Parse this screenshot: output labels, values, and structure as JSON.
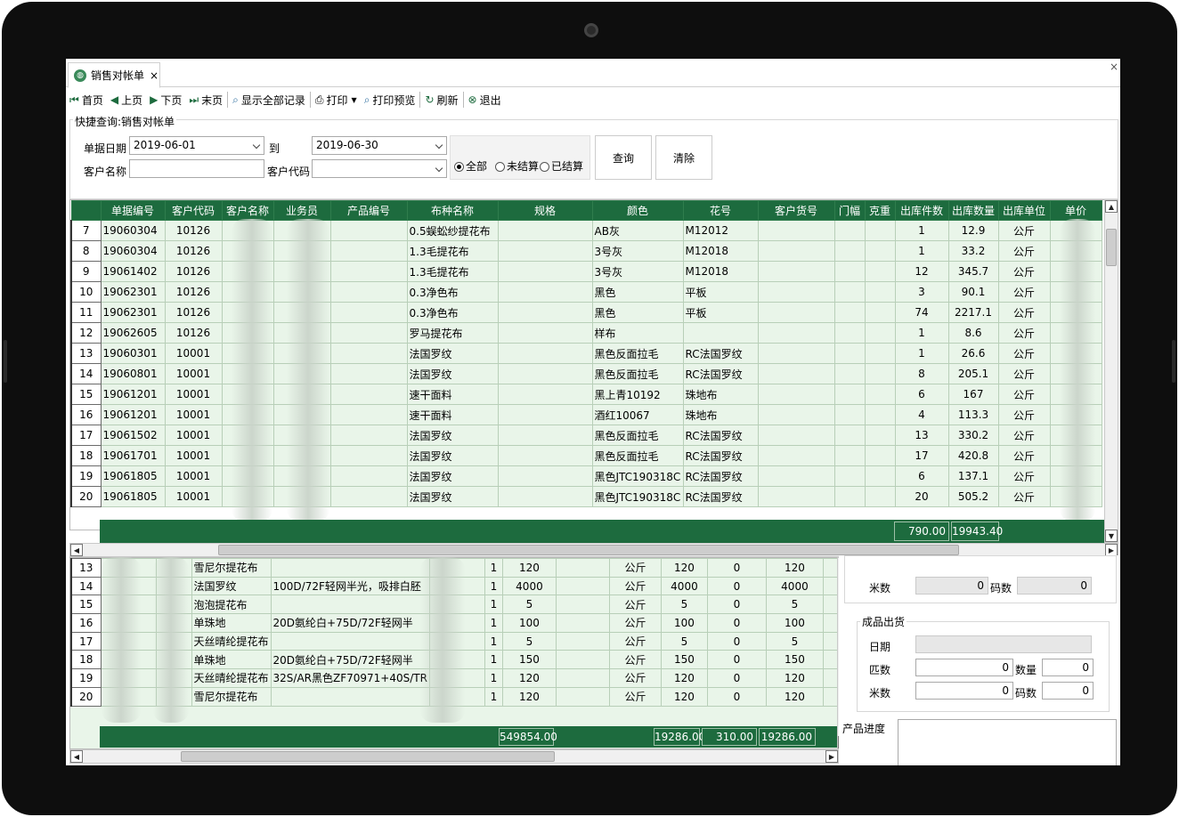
{
  "tab": {
    "title": "销售对帐单",
    "close": "×"
  },
  "window": {
    "close": "×"
  },
  "toolbar": {
    "first": "首页",
    "prev": "上页",
    "next": "下页",
    "last": "末页",
    "show_all": "显示全部记录",
    "print": "打印",
    "print_preview": "打印预览",
    "refresh": "刷新",
    "exit": "退出"
  },
  "query": {
    "legend": "快捷查询:销售对帐单",
    "date_label": "单据日期",
    "date_from": "2019-06-01",
    "to_label": "到",
    "date_to": "2019-06-30",
    "customer_name_label": "客户名称",
    "customer_name": "",
    "customer_code_label": "客户代码",
    "customer_code": "",
    "radio_all": "全部",
    "radio_unsettled": "未结算",
    "radio_settled": "已结算",
    "radio_selected": "全部",
    "query_button": "查询",
    "clear_button": "清除"
  },
  "grid1": {
    "headers": [
      "单据编号",
      "客户代码",
      "客户名称",
      "业务员",
      "产品编号",
      "布种名称",
      "规格",
      "颜色",
      "花号",
      "客户货号",
      "门幅",
      "克重",
      "出库件数",
      "出库数量",
      "出库单位",
      "单价"
    ],
    "rows": [
      {
        "n": "7",
        "doc": "19060304",
        "code": "10126",
        "fabric": "0.5蜈蚣纱提花布",
        "color": "AB灰",
        "pattern": "M12012",
        "pcs": "1",
        "qty": "12.9",
        "unit": "公斤"
      },
      {
        "n": "8",
        "doc": "19060304",
        "code": "10126",
        "fabric": "1.3毛提花布",
        "color": "3号灰",
        "pattern": "M12018",
        "pcs": "1",
        "qty": "33.2",
        "unit": "公斤"
      },
      {
        "n": "9",
        "doc": "19061402",
        "code": "10126",
        "fabric": "1.3毛提花布",
        "color": "3号灰",
        "pattern": "M12018",
        "pcs": "12",
        "qty": "345.7",
        "unit": "公斤"
      },
      {
        "n": "10",
        "doc": "19062301",
        "code": "10126",
        "fabric": "0.3净色布",
        "color": "黑色",
        "pattern": "平板",
        "pcs": "3",
        "qty": "90.1",
        "unit": "公斤"
      },
      {
        "n": "11",
        "doc": "19062301",
        "code": "10126",
        "fabric": "0.3净色布",
        "color": "黑色",
        "pattern": "平板",
        "pcs": "74",
        "qty": "2217.1",
        "unit": "公斤"
      },
      {
        "n": "12",
        "doc": "19062605",
        "code": "10126",
        "fabric": "罗马提花布",
        "color": "样布",
        "pattern": "",
        "pcs": "1",
        "qty": "8.6",
        "unit": "公斤"
      },
      {
        "n": "13",
        "doc": "19060301",
        "code": "10001",
        "fabric": "法国罗纹",
        "color": "黑色反面拉毛",
        "pattern": "RC法国罗纹",
        "pcs": "1",
        "qty": "26.6",
        "unit": "公斤"
      },
      {
        "n": "14",
        "doc": "19060801",
        "code": "10001",
        "fabric": "法国罗纹",
        "color": "黑色反面拉毛",
        "pattern": "RC法国罗纹",
        "pcs": "8",
        "qty": "205.1",
        "unit": "公斤"
      },
      {
        "n": "15",
        "doc": "19061201",
        "code": "10001",
        "fabric": "速干面料",
        "color": "黑上青10192",
        "pattern": "珠地布",
        "pcs": "6",
        "qty": "167",
        "unit": "公斤"
      },
      {
        "n": "16",
        "doc": "19061201",
        "code": "10001",
        "fabric": "速干面料",
        "color": "酒红10067",
        "pattern": "珠地布",
        "pcs": "4",
        "qty": "113.3",
        "unit": "公斤"
      },
      {
        "n": "17",
        "doc": "19061502",
        "code": "10001",
        "fabric": "法国罗纹",
        "color": "黑色反面拉毛",
        "pattern": "RC法国罗纹",
        "pcs": "13",
        "qty": "330.2",
        "unit": "公斤"
      },
      {
        "n": "18",
        "doc": "19061701",
        "code": "10001",
        "fabric": "法国罗纹",
        "color": "黑色反面拉毛",
        "pattern": "RC法国罗纹",
        "pcs": "17",
        "qty": "420.8",
        "unit": "公斤"
      },
      {
        "n": "19",
        "doc": "19061805",
        "code": "10001",
        "fabric": "法国罗纹",
        "color": "黑色JTC190318C",
        "pattern": "RC法国罗纹",
        "pcs": "6",
        "qty": "137.1",
        "unit": "公斤"
      },
      {
        "n": "20",
        "doc": "19061805",
        "code": "10001",
        "fabric": "法国罗纹",
        "color": "黑色JTC190318C",
        "pattern": "RC法国罗纹",
        "pcs": "20",
        "qty": "505.2",
        "unit": "公斤"
      }
    ],
    "sum_pcs": "790.00",
    "sum_qty": "19943.40"
  },
  "grid2": {
    "rows": [
      {
        "n": "13",
        "name": "雪尼尔提花布",
        "spec": "",
        "a": "1",
        "b": "120",
        "unit": "公斤",
        "c": "120",
        "d": "0",
        "e": "120"
      },
      {
        "n": "14",
        "name": "法国罗纹",
        "spec": "100D/72F轻网半光，吸排白胚",
        "a": "1",
        "b": "4000",
        "unit": "公斤",
        "c": "4000",
        "d": "0",
        "e": "4000"
      },
      {
        "n": "15",
        "name": "泡泡提花布",
        "spec": "",
        "a": "1",
        "b": "5",
        "unit": "公斤",
        "c": "5",
        "d": "0",
        "e": "5"
      },
      {
        "n": "16",
        "name": "单珠地",
        "spec": "20D氨纶白+75D/72F轻网半",
        "a": "1",
        "b": "100",
        "unit": "公斤",
        "c": "100",
        "d": "0",
        "e": "100"
      },
      {
        "n": "17",
        "name": "天丝晴纶提花布",
        "spec": "",
        "a": "1",
        "b": "5",
        "unit": "公斤",
        "c": "5",
        "d": "0",
        "e": "5"
      },
      {
        "n": "18",
        "name": "单珠地",
        "spec": "20D氨纶白+75D/72F轻网半",
        "a": "1",
        "b": "150",
        "unit": "公斤",
        "c": "150",
        "d": "0",
        "e": "150"
      },
      {
        "n": "19",
        "name": "天丝晴纶提花布",
        "spec": "32S/AR黑色ZF70971+40S/TR",
        "a": "1",
        "b": "120",
        "unit": "公斤",
        "c": "120",
        "d": "0",
        "e": "120"
      },
      {
        "n": "20",
        "name": "雪尼尔提花布",
        "spec": "",
        "a": "1",
        "b": "120",
        "unit": "公斤",
        "c": "120",
        "d": "0",
        "e": "120"
      }
    ],
    "sum_b": "549854.00",
    "sum_c": "19286.00",
    "sum_d": "310.00",
    "sum_e": "19286.00"
  },
  "right_panel": {
    "meters_label": "米数",
    "meters_value": "0",
    "yards_label": "码数",
    "yards_value": "0",
    "finished_legend": "成品出货",
    "date_label": "日期",
    "date_value": "",
    "pieces_label": "匹数",
    "pieces_value": "0",
    "qty_label": "数量",
    "qty_value": "0",
    "meters2_label": "米数",
    "meters2_value": "0",
    "yards2_label": "码数",
    "yards2_value": "0",
    "progress_label": "产品进度",
    "progress_value": ""
  }
}
